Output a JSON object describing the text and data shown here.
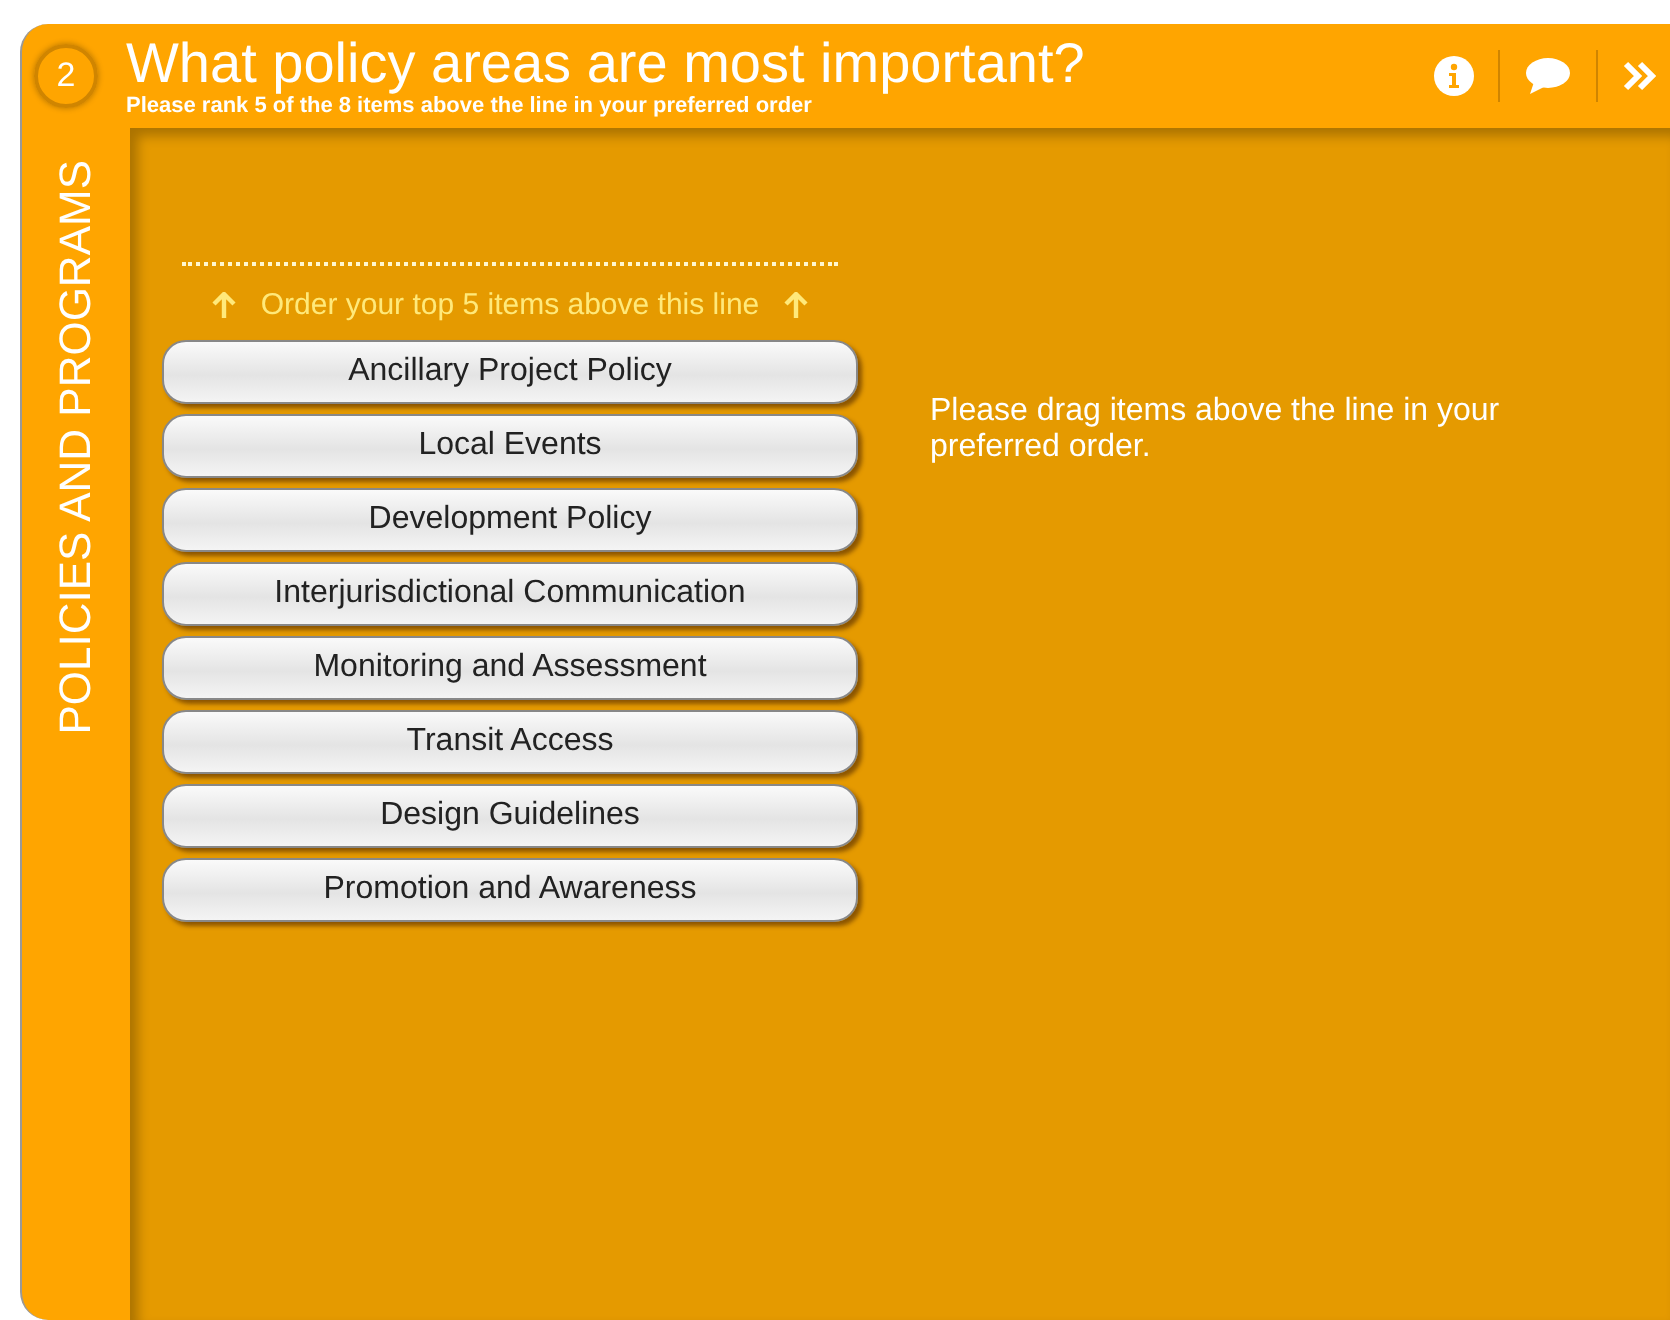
{
  "question": {
    "number": "2",
    "title": "What policy areas are most important?",
    "subtitle": "Please rank 5 of the 8 items above the line in your preferred order"
  },
  "section": "POLICIES AND PROGRAMS",
  "ranking": {
    "line_label": "Order your top 5 items above this line",
    "items": [
      {
        "label": "Ancillary Project Policy"
      },
      {
        "label": "Local Events"
      },
      {
        "label": "Development Policy"
      },
      {
        "label": "Interjurisdictional Communication"
      },
      {
        "label": "Monitoring and Assessment"
      },
      {
        "label": "Transit Access"
      },
      {
        "label": "Design Guidelines"
      },
      {
        "label": "Promotion and Awareness"
      }
    ]
  },
  "instruction": "Please drag items above the line in your preferred order."
}
